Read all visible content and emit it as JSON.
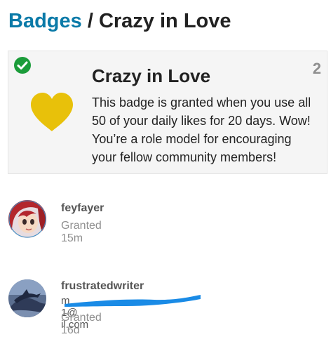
{
  "header": {
    "crumb_label": "Badges",
    "separator": "/",
    "title": "Crazy in Love"
  },
  "badge": {
    "title": "Crazy in Love",
    "description": "This badge is granted when you use all 50 of your daily likes for 20 days. Wow! You’re a role model for encouraging your fellow community members!",
    "grant_count": "2",
    "icon": "heart-icon",
    "icon_color": "#e8c10a",
    "status_icon": "check-circle-icon",
    "status_color": "#1b9c3a"
  },
  "users": [
    {
      "username": "feyfayer",
      "granted": "Granted 15m"
    },
    {
      "username": "frustratedwriter",
      "email_partial": "m          1@    il.com",
      "granted": "Granted 16d"
    }
  ],
  "colors": {
    "link": "#0a7aa8",
    "redaction": "#1a8be6"
  }
}
